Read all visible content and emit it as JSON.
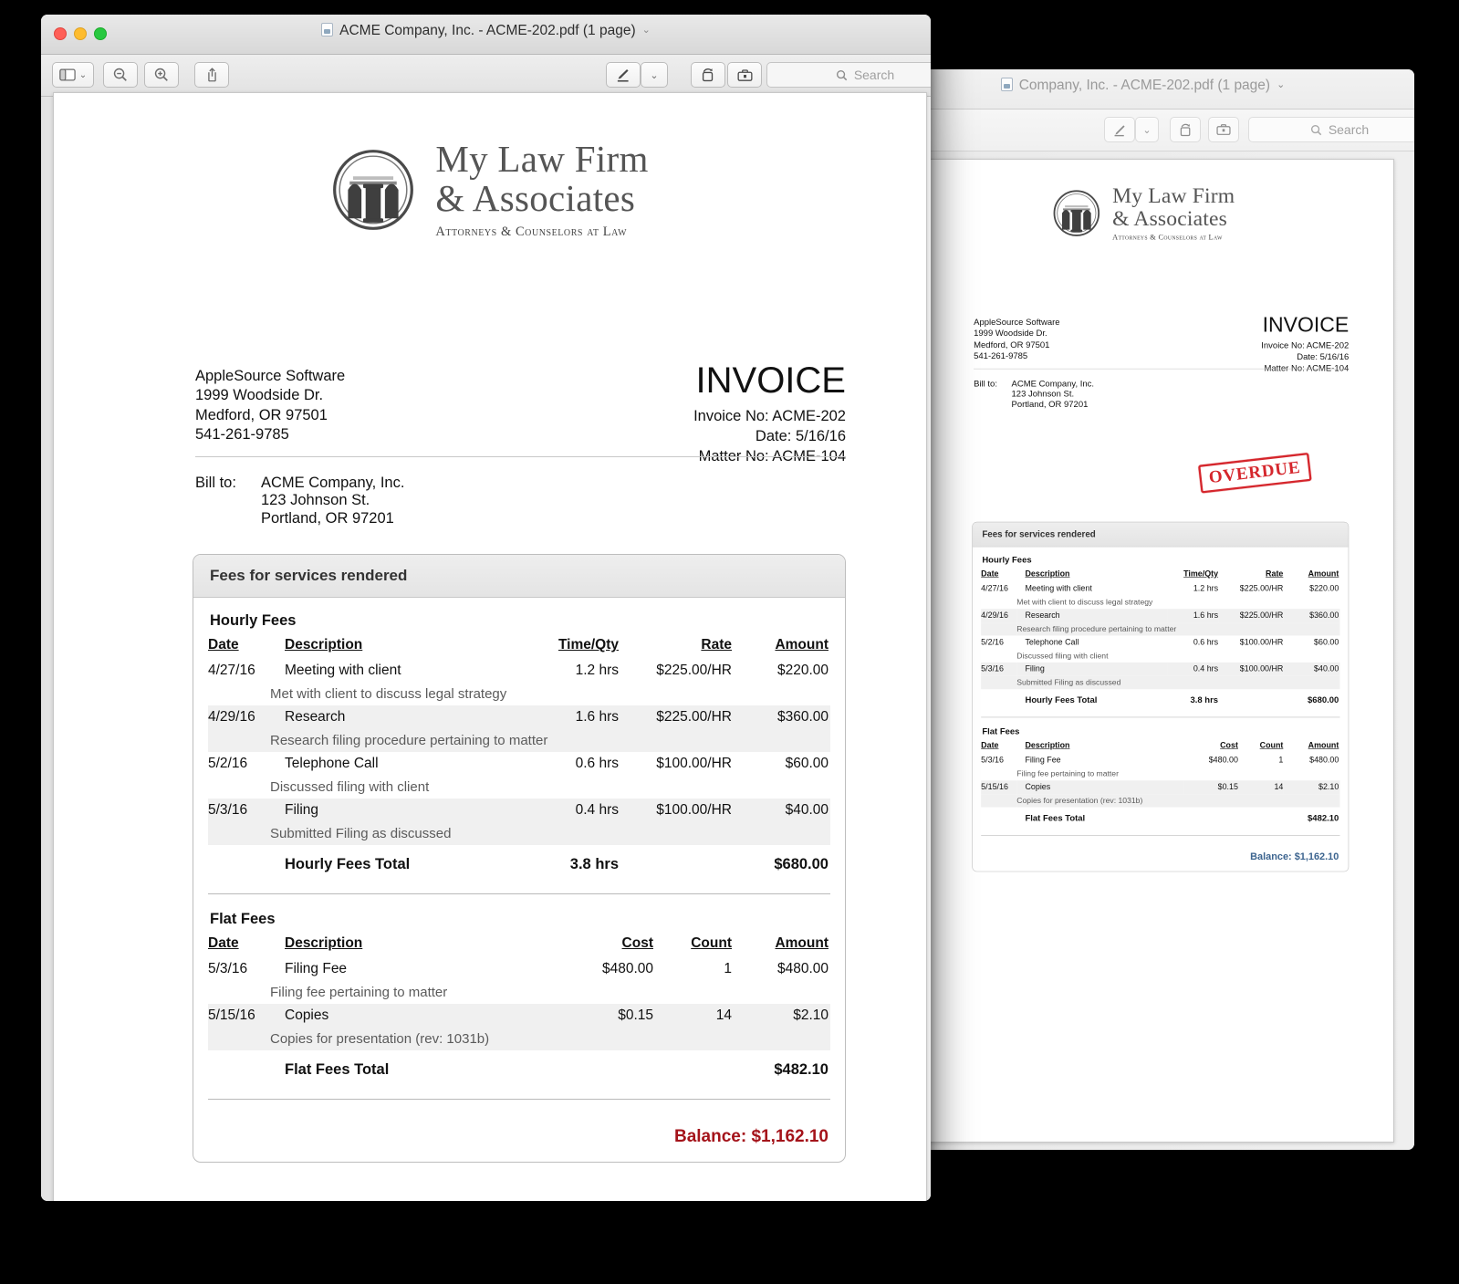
{
  "windows": {
    "front": {
      "title": "ACME Company, Inc. - ACME-202.pdf (1 page)",
      "title_chevron": "⌄",
      "toolbar": {
        "sidebar_button": "sidebar-toggle",
        "sidebar_chevron": "⌄",
        "zoom_out_button": "zoom-out",
        "zoom_in_button": "zoom-in",
        "share_button": "share",
        "markup_button": "markup-pen",
        "markup_chevron": "⌄",
        "rotate_button": "rotate-left",
        "toolbox_button": "markup-toolbar",
        "search_placeholder": "Search"
      }
    },
    "back": {
      "title": "Company, Inc. - ACME-202.pdf (1 page)",
      "title_chevron": "⌄",
      "toolbar": {
        "markup_button": "markup-pen",
        "markup_chevron": "⌄",
        "rotate_button": "rotate-left",
        "toolbox_button": "markup-toolbar",
        "search_placeholder": "Search"
      }
    }
  },
  "invoice": {
    "logo": {
      "line1": "My Law Firm",
      "line2": "& Associates",
      "tagline": "Attorneys & Counselors at Law"
    },
    "sender": {
      "name": "AppleSource Software",
      "street": "1999 Woodside Dr.",
      "city": "Medford, OR 97501",
      "phone": "541-261-9785"
    },
    "heading": "INVOICE",
    "meta": {
      "invoice_no": "Invoice No: ACME-202",
      "date": "Date: 5/16/16",
      "matter_no": "Matter No: ACME-104"
    },
    "bill_to": {
      "label": "Bill to:",
      "name": "ACME Company, Inc.",
      "street": "123 Johnson St.",
      "city": "Portland, OR 97201"
    },
    "stamp": "OVERDUE",
    "card_title": "Fees for services rendered",
    "hourly": {
      "group_title": "Hourly Fees",
      "headers": {
        "date": "Date",
        "description": "Description",
        "qty": "Time/Qty",
        "rate": "Rate",
        "amount": "Amount"
      },
      "rows": [
        {
          "date": "4/27/16",
          "desc": "Meeting with client",
          "note": "Met with client to discuss legal strategy",
          "qty": "1.2 hrs",
          "rate": "$225.00/HR",
          "amount": "$220.00"
        },
        {
          "date": "4/29/16",
          "desc": "Research",
          "note": "Research filing procedure pertaining to matter",
          "qty": "1.6 hrs",
          "rate": "$225.00/HR",
          "amount": "$360.00"
        },
        {
          "date": "5/2/16",
          "desc": "Telephone Call",
          "note": "Discussed filing with client",
          "qty": "0.6 hrs",
          "rate": "$100.00/HR",
          "amount": "$60.00"
        },
        {
          "date": "5/3/16",
          "desc": "Filing",
          "note": "Submitted Filing as discussed",
          "qty": "0.4 hrs",
          "rate": "$100.00/HR",
          "amount": "$40.00"
        }
      ],
      "total": {
        "label": "Hourly Fees Total",
        "qty": "3.8 hrs",
        "amount": "$680.00"
      }
    },
    "flat": {
      "group_title": "Flat Fees",
      "headers": {
        "date": "Date",
        "description": "Description",
        "cost": "Cost",
        "count": "Count",
        "amount": "Amount"
      },
      "rows": [
        {
          "date": "5/3/16",
          "desc": "Filing Fee",
          "note": "Filing fee pertaining to matter",
          "cost": "$480.00",
          "count": "1",
          "amount": "$480.00"
        },
        {
          "date": "5/15/16",
          "desc": "Copies",
          "note": "Copies for presentation (rev: 1031b)",
          "cost": "$0.15",
          "count": "14",
          "amount": "$2.10"
        }
      ],
      "total": {
        "label": "Flat Fees Total",
        "amount": "$482.10"
      }
    },
    "balance_front": "Balance: $1,162.10",
    "balance_back": "Balance: $1,162.10"
  },
  "colors": {
    "balance_red": "#a4131a",
    "balance_blue": "#3c648f",
    "stamp_red": "#d5262c",
    "row_alt": "#f0f0f0",
    "traffic_close": "#ff5f57",
    "traffic_min": "#febc2e",
    "traffic_max": "#28c840"
  }
}
